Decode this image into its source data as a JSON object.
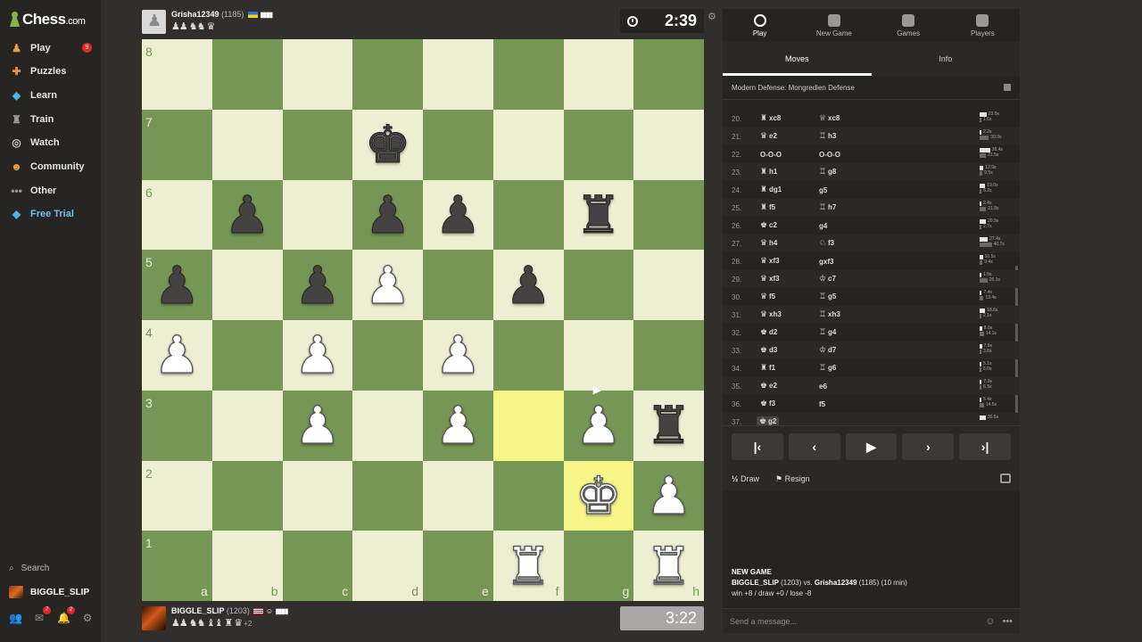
{
  "sidebar": {
    "logo": "Chess",
    "logo_suffix": ".com",
    "items": [
      {
        "label": "Play",
        "icon": "play-pawn-icon",
        "color": "#e8a048"
      },
      {
        "label": "Puzzles",
        "icon": "puzzle-icon",
        "color": "#f08a3c"
      },
      {
        "label": "Learn",
        "icon": "learn-cube-icon",
        "color": "#4ab3e8"
      },
      {
        "label": "Train",
        "icon": "train-icon",
        "color": "#9a9896"
      },
      {
        "label": "Watch",
        "icon": "binoculars-icon",
        "color": "#c8c6c4"
      },
      {
        "label": "Community",
        "icon": "community-icon",
        "color": "#e8a048"
      },
      {
        "label": "Other",
        "icon": "dots-icon",
        "color": "#9a9896"
      },
      {
        "label": "Free Trial",
        "icon": "diamond-icon",
        "color": "#4ab3e8"
      }
    ],
    "play_badge": "9",
    "search_label": "Search",
    "username": "BIGGLE_SLIP",
    "mail_badge": "7",
    "bell_badge": "2"
  },
  "top_player": {
    "name": "Grisha12349",
    "rating": "(1185)",
    "captured": "♟♟ ♞♞ ♛",
    "clock": "2:39"
  },
  "bottom_player": {
    "name": "BIGGLE_SLIP",
    "rating": "(1203)",
    "captured": "♟♟ ♞♞ ♝♝ ♜ ♛",
    "advantage": "+2",
    "clock": "3:22"
  },
  "board": {
    "ranks": [
      "8",
      "7",
      "6",
      "5",
      "4",
      "3",
      "2",
      "1"
    ],
    "files": [
      "a",
      "b",
      "c",
      "d",
      "e",
      "f",
      "g",
      "h"
    ],
    "highlighted": [
      "f3",
      "g2"
    ],
    "pieces": {
      "d7": "bk",
      "b6": "bp",
      "d6": "bp",
      "e6": "bp",
      "g6": "br",
      "a5": "bp",
      "c5": "bp",
      "d5": "wp",
      "f5": "bp",
      "a4": "wp",
      "c4": "wp",
      "e4": "wp",
      "c3": "wp",
      "e3": "wp",
      "g3": "wp",
      "h3": "br",
      "g2": "wk",
      "h2": "wp",
      "f1": "wr",
      "h1": "wr"
    }
  },
  "panel": {
    "tabs": [
      {
        "label": "Play",
        "icon": "stopwatch-icon"
      },
      {
        "label": "New Game",
        "icon": "plus-square-icon"
      },
      {
        "label": "Games",
        "icon": "board-grid-icon"
      },
      {
        "label": "Players",
        "icon": "players-icon"
      }
    ],
    "subtabs": [
      "Moves",
      "Info"
    ],
    "opening": "Modern Defense: Mongredien Defense",
    "moves": [
      {
        "num": "20.",
        "w": "xc8",
        "wp": "♜",
        "b": "xc8",
        "bp": "♕",
        "wt": "23.0s",
        "bt": "1.6s"
      },
      {
        "num": "21.",
        "w": "e2",
        "wp": "♛",
        "b": "h3",
        "bp": "♖",
        "wt": "2.2s",
        "bt": "30.9s"
      },
      {
        "num": "22.",
        "w": "O-O-O",
        "wp": "",
        "b": "O-O-O",
        "bp": "",
        "wt": "35.4s",
        "bt": "21.5s"
      },
      {
        "num": "23.",
        "w": "h1",
        "wp": "♜",
        "b": "g8",
        "bp": "♖",
        "wt": "12.9s",
        "bt": "9.5s"
      },
      {
        "num": "24.",
        "w": "dg1",
        "wp": "♜",
        "b": "g5",
        "bp": "",
        "wt": "19.0s",
        "bt": "6.2s"
      },
      {
        "num": "25.",
        "w": "f5",
        "wp": "♜",
        "b": "h7",
        "bp": "♖",
        "wt": "2.4s",
        "bt": "21.8s"
      },
      {
        "num": "26.",
        "w": "c2",
        "wp": "♚",
        "b": "g4",
        "bp": "",
        "wt": "20.9s",
        "bt": "2.7s"
      },
      {
        "num": "27.",
        "w": "h4",
        "wp": "♛",
        "b": "f3",
        "bp": "♘",
        "wt": "27.4s",
        "bt": "40.7s"
      },
      {
        "num": "28.",
        "w": "xf3",
        "wp": "♛",
        "b": "gxf3",
        "bp": "",
        "wt": "10.5s",
        "bt": "9.4s"
      },
      {
        "num": "29.",
        "w": "xf3",
        "wp": "♛",
        "b": "c7",
        "bp": "♔",
        "wt": "1.9s",
        "bt": "26.1s"
      },
      {
        "num": "30.",
        "w": "f5",
        "wp": "♛",
        "b": "g5",
        "bp": "♖",
        "wt": "7.4s",
        "bt": "13.4s"
      },
      {
        "num": "31.",
        "w": "xh3",
        "wp": "♛",
        "b": "xh3",
        "bp": "♖",
        "wt": "18.6s",
        "bt": "2.1s"
      },
      {
        "num": "32.",
        "w": "d2",
        "wp": "♚",
        "b": "g4",
        "bp": "♖",
        "wt": "8.0s",
        "bt": "14.1s"
      },
      {
        "num": "33.",
        "w": "d3",
        "wp": "♚",
        "b": "d7",
        "bp": "♔",
        "wt": "7.5s",
        "bt": "3.6s"
      },
      {
        "num": "34.",
        "w": "f1",
        "wp": "♜",
        "b": "g6",
        "bp": "♖",
        "wt": "5.1s",
        "bt": "6.0s"
      },
      {
        "num": "35.",
        "w": "e2",
        "wp": "♚",
        "b": "e6",
        "bp": "",
        "wt": "7.3s",
        "bt": "6.5s"
      },
      {
        "num": "36.",
        "w": "f3",
        "wp": "♚",
        "b": "f5",
        "bp": "",
        "wt": "5.4s",
        "bt": "14.5s"
      },
      {
        "num": "37.",
        "w": "g2",
        "wp": "♚",
        "b": "",
        "bp": "",
        "wt": "20.6s",
        "bt": ""
      }
    ],
    "controls": [
      "|‹",
      "‹",
      "▶",
      "›",
      "›|"
    ],
    "draw_label": "Draw",
    "draw_prefix": "½",
    "resign_label": "Resign",
    "chat": {
      "header": "NEW GAME",
      "line1_a": "BIGGLE_SLIP",
      "line1_b": " (1203) vs. ",
      "line1_c": "Grisha12349",
      "line1_d": " (1185) (10 min)",
      "line2": "win +8 / draw +0 / lose -8"
    },
    "message_placeholder": "Send a message..."
  }
}
